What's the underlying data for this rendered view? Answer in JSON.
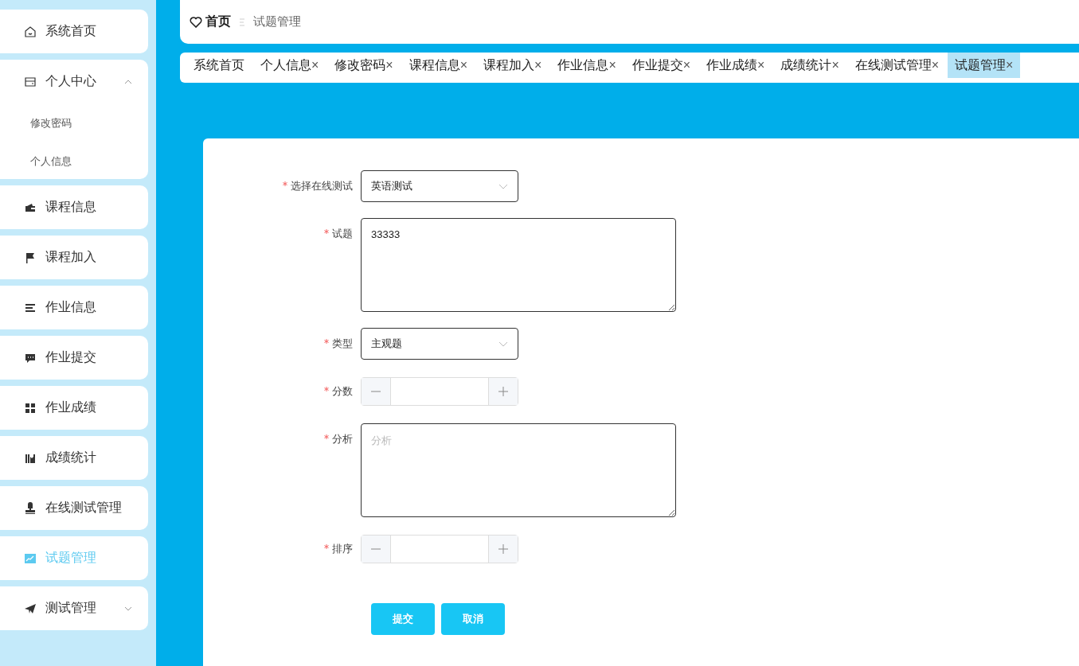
{
  "sidebar": {
    "items": [
      {
        "label": "系统首页",
        "selected": false
      },
      {
        "label": "个人中心",
        "selected": false,
        "expanded": true,
        "children": [
          {
            "label": "修改密码",
            "selected": false
          },
          {
            "label": "个人信息",
            "selected": false
          }
        ]
      },
      {
        "label": "课程信息",
        "selected": false
      },
      {
        "label": "课程加入",
        "selected": false
      },
      {
        "label": "作业信息",
        "selected": false
      },
      {
        "label": "作业提交",
        "selected": false
      },
      {
        "label": "作业成绩",
        "selected": false
      },
      {
        "label": "成绩统计",
        "selected": false
      },
      {
        "label": "在线测试管理",
        "selected": false
      },
      {
        "label": "试题管理",
        "selected": true
      },
      {
        "label": "测试管理",
        "selected": false,
        "expanded": false
      }
    ]
  },
  "breadcrumb": {
    "home": "首页",
    "current": "试题管理"
  },
  "tabs": [
    {
      "label": "系统首页",
      "selected": false
    },
    {
      "label": "个人信息",
      "close": "×",
      "selected": false
    },
    {
      "label": "修改密码",
      "close": "×",
      "selected": false
    },
    {
      "label": "课程信息",
      "close": "×",
      "selected": false
    },
    {
      "label": "课程加入",
      "close": "×",
      "selected": false
    },
    {
      "label": "作业信息",
      "close": "×",
      "selected": false
    },
    {
      "label": "作业提交",
      "close": "×",
      "selected": false
    },
    {
      "label": "作业成绩",
      "close": "×",
      "selected": false
    },
    {
      "label": "成绩统计",
      "close": "×",
      "selected": false
    },
    {
      "label": "在线测试管理",
      "close": "×",
      "selected": false
    },
    {
      "label": "试题管理",
      "close": "×",
      "selected": true
    }
  ],
  "form": {
    "fields": [
      {
        "kind": "select",
        "label": "选择在线测试",
        "required": true,
        "value": "英语测试"
      },
      {
        "kind": "textarea",
        "label": "试题",
        "required": true,
        "value": "33333"
      },
      {
        "kind": "select",
        "label": "类型",
        "required": true,
        "value": "主观题"
      },
      {
        "kind": "number",
        "label": "分数",
        "required": true
      },
      {
        "kind": "textarea",
        "label": "分析",
        "required": true,
        "placeholder": "分析"
      },
      {
        "kind": "number",
        "label": "排序",
        "required": true
      }
    ],
    "buttons": [
      {
        "label": "提交"
      },
      {
        "label": "取消"
      }
    ]
  }
}
